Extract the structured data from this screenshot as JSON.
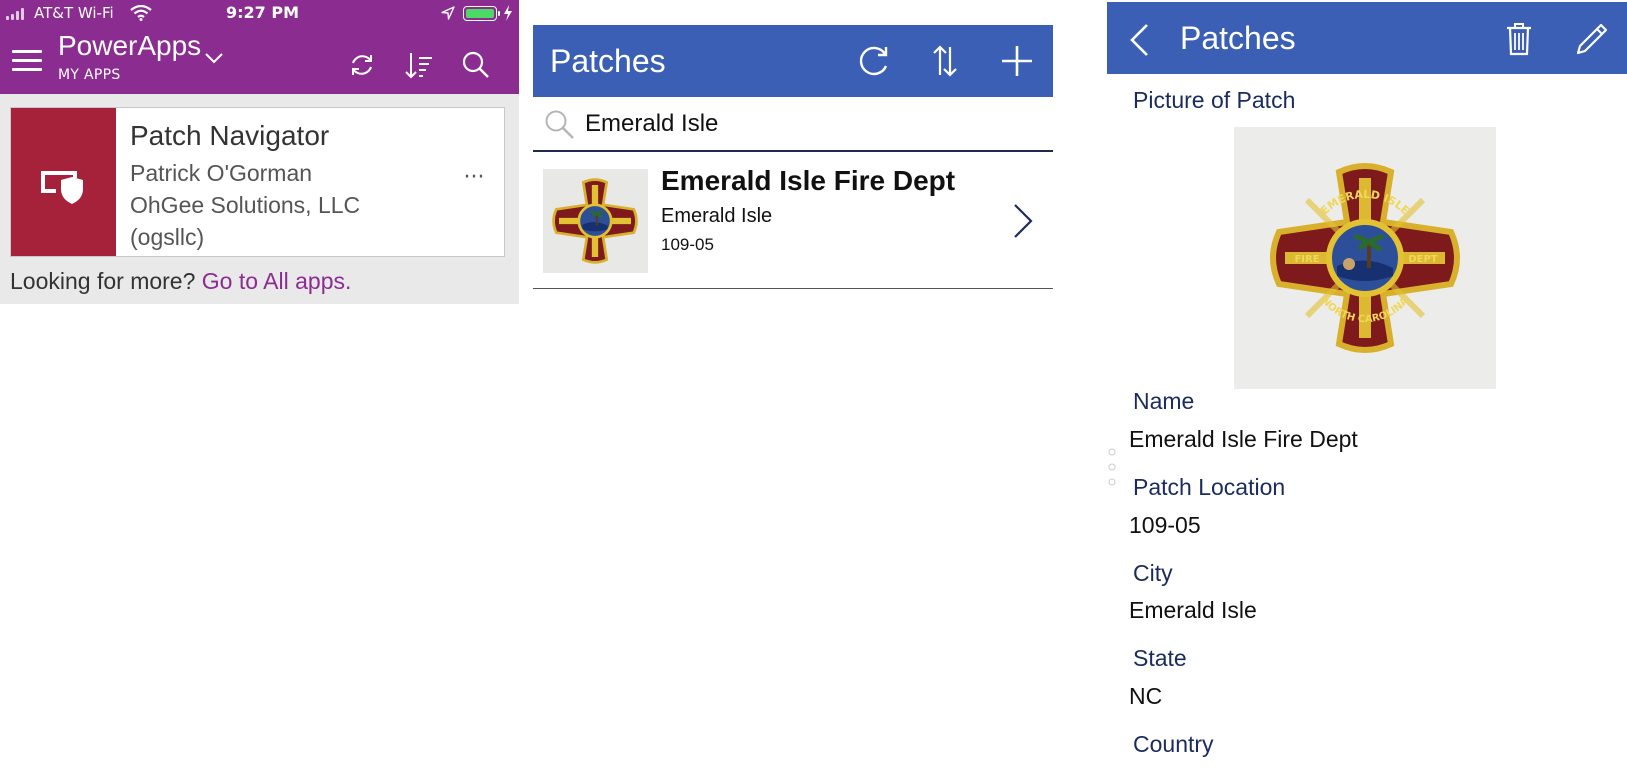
{
  "status_bar": {
    "carrier": "AT&T Wi-Fi",
    "time": "9:27 PM"
  },
  "powerapps": {
    "title": "PowerApps",
    "subtitle": "MY APPS",
    "app_card": {
      "name": "Patch Navigator",
      "author": "Patrick O'Gorman",
      "company": "OhGee Solutions, LLC",
      "tenant": "(ogsllc)",
      "more": "···"
    },
    "footer": {
      "prompt": "Looking for more?",
      "link": "Go to All apps."
    },
    "colors": {
      "header": "#8b2d90",
      "tile": "#a6223a"
    }
  },
  "patches_list": {
    "title": "Patches",
    "search": {
      "value": "Emerald Isle"
    },
    "items": [
      {
        "title": "Emerald Isle Fire Dept",
        "subtitle": "Emerald Isle",
        "code": "109-05"
      }
    ],
    "colors": {
      "header": "#3a5fb5"
    }
  },
  "patch_detail": {
    "title": "Patches",
    "fields": {
      "picture_label": "Picture of Patch",
      "name_label": "Name",
      "name_value": "Emerald Isle Fire Dept",
      "location_label": "Patch Location",
      "location_value": "109-05",
      "city_label": "City",
      "city_value": "Emerald Isle",
      "state_label": "State",
      "state_value": "NC",
      "country_label": "Country"
    },
    "patch_text": {
      "top": "EMERALD ISLE",
      "left": "FIRE",
      "right": "DEPT",
      "bottom": "NORTH CAROLINA"
    }
  }
}
